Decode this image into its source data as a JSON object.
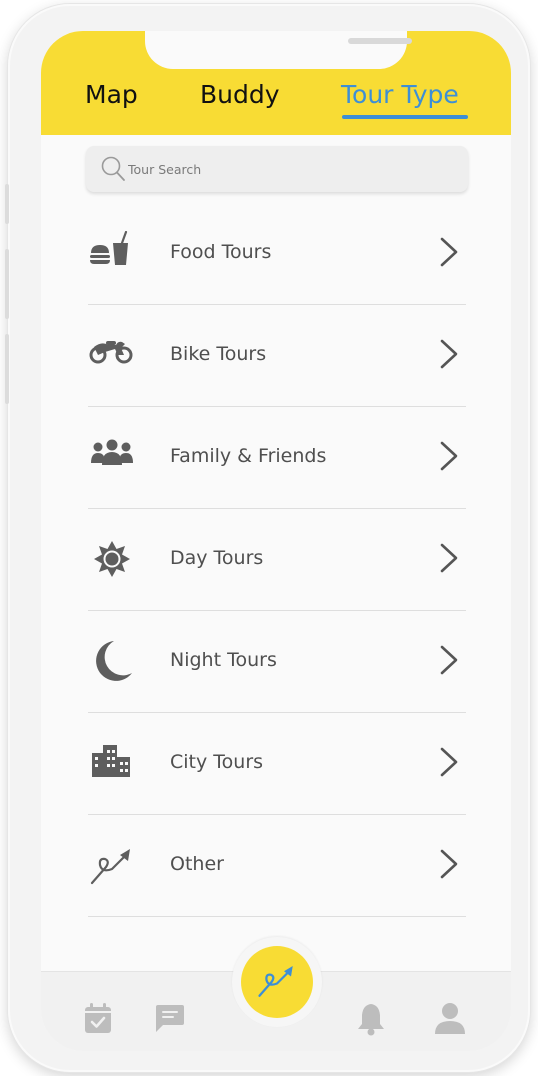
{
  "tabs": [
    {
      "label": "Map",
      "active": false
    },
    {
      "label": "Buddy",
      "active": false
    },
    {
      "label": "Tour Type",
      "active": true
    }
  ],
  "search": {
    "placeholder": "Tour Search",
    "icon": "search-icon"
  },
  "tour_types": [
    {
      "label": "Food Tours",
      "icon": "food-drink-icon"
    },
    {
      "label": "Bike Tours",
      "icon": "motorbike-icon"
    },
    {
      "label": "Family & Friends",
      "icon": "group-icon"
    },
    {
      "label": "Day Tours",
      "icon": "sun-icon"
    },
    {
      "label": "Night Tours",
      "icon": "moon-icon"
    },
    {
      "label": "City Tours",
      "icon": "city-icon"
    },
    {
      "label": "Other",
      "icon": "route-arrow-icon"
    }
  ],
  "bottom_nav": [
    {
      "icon": "calendar-check-icon"
    },
    {
      "icon": "chat-icon"
    },
    {
      "icon": "route-arrow-icon",
      "primary": true
    },
    {
      "icon": "bell-icon"
    },
    {
      "icon": "profile-icon"
    }
  ],
  "colors": {
    "header": "#f8dc34",
    "active_tab": "#3d8fd6",
    "text": "#4f4f4f",
    "icon": "#5e5e5e"
  }
}
